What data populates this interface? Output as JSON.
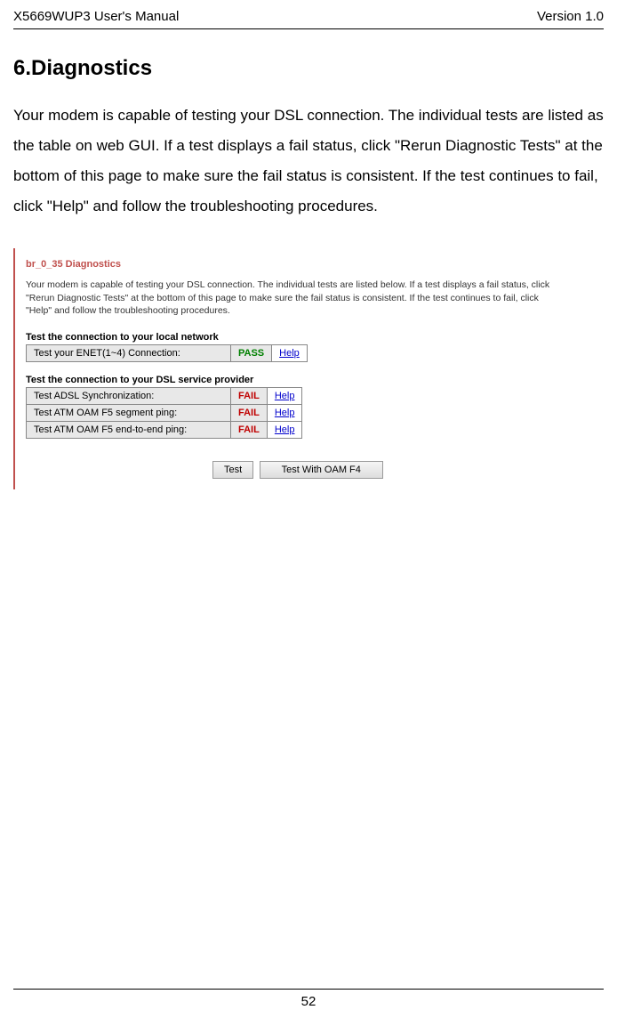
{
  "header": {
    "left": "X5669WUP3 User's Manual",
    "right": "Version 1.0"
  },
  "section": {
    "title": "6.Diagnostics",
    "body": "Your modem is capable of testing your DSL connection. The individual tests are listed as the table on web GUI. If a test displays a fail status, click \"Rerun Diagnostic Tests\" at the bottom of this page to make sure the fail status is consistent. If the test continues to fail, click \"Help\" and follow the troubleshooting procedures."
  },
  "gui": {
    "title": "br_0_35 Diagnostics",
    "description": "Your modem is capable of testing your DSL connection. The individual tests are listed below. If a test displays a fail status, click \"Rerun Diagnostic Tests\" at the bottom of this page to make sure the fail status is consistent. If the test continues to fail, click \"Help\" and follow the troubleshooting procedures.",
    "local_subtitle": "Test the connection to your local network",
    "local_tests": [
      {
        "name": "Test your ENET(1~4) Connection:",
        "status": "PASS",
        "help": "Help"
      }
    ],
    "dsl_subtitle": "Test the connection to your DSL service provider",
    "dsl_tests": [
      {
        "name": "Test ADSL Synchronization:",
        "status": "FAIL",
        "help": "Help"
      },
      {
        "name": "Test ATM OAM F5 segment ping:",
        "status": "FAIL",
        "help": "Help"
      },
      {
        "name": "Test ATM OAM F5 end-to-end ping:",
        "status": "FAIL",
        "help": "Help"
      }
    ],
    "buttons": {
      "test": "Test",
      "test_oam": "Test With OAM F4"
    }
  },
  "footer": {
    "page_number": "52"
  }
}
